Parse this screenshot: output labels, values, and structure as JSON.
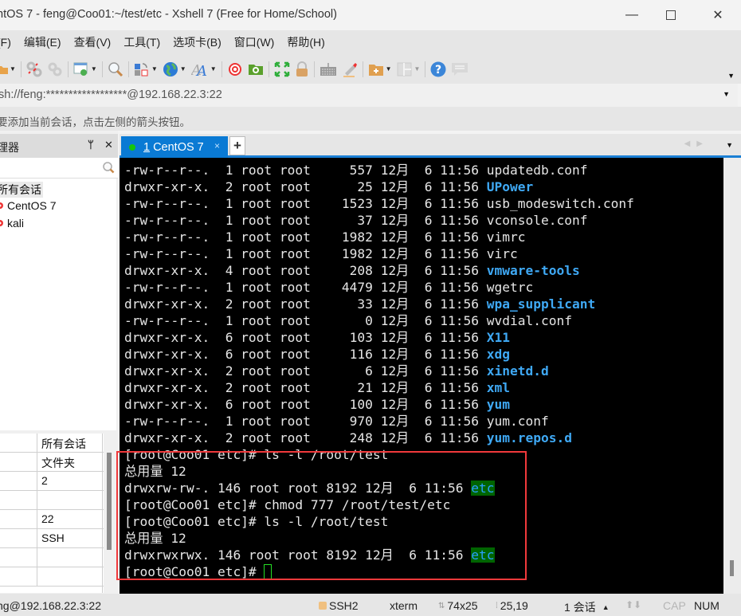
{
  "window": {
    "title": "ntOS 7 - feng@Coo01:~/test/etc - Xshell 7 (Free for Home/School)",
    "minimize_glyph": "—",
    "close_glyph": "✕"
  },
  "menu": [
    "(F)",
    "编辑(E)",
    "查看(V)",
    "工具(T)",
    "选项卡(B)",
    "窗口(W)",
    "帮助(H)"
  ],
  "toolbar": {
    "buttons": [
      "open-folder",
      "disconnect",
      "reconnect",
      "session-properties",
      "find",
      "transfer",
      "globe",
      "font",
      "xftp-swirl",
      "xftp",
      "fullscreen",
      "lock",
      "keyboard",
      "highlighter",
      "new-folder",
      "layout",
      "help",
      "chat"
    ],
    "more_glyph": "▼"
  },
  "address": {
    "value": "sh://feng:******************@192.168.22.3:22",
    "drop_glyph": "▼"
  },
  "hint": "要添加当前会话，点击左侧的箭头按钮。",
  "session_panel": {
    "title": "理器",
    "pin_glyph": "ᛘ",
    "close_glyph": "✕",
    "tree": {
      "root": "所有会话",
      "children": [
        "CentOS 7",
        "kali"
      ]
    },
    "properties": [
      "所有会话",
      "文件夹",
      "2",
      "",
      "22",
      "SSH",
      "",
      ""
    ]
  },
  "tabs": {
    "items": [
      {
        "number": "1",
        "label": "CentOS 7",
        "status_color": "#16c60c"
      }
    ],
    "close_glyph": "×",
    "add_glyph": "+",
    "nav_glyphs": "◀▶",
    "menu_glyph": "▼"
  },
  "terminal": {
    "listing": [
      {
        "perm": "-rw-r--r--.",
        "links": "1",
        "user": "root",
        "group": "root",
        "size": "557",
        "month": "12月",
        "day": "6",
        "time": "11:56",
        "name": "updatedb.conf",
        "dir": false
      },
      {
        "perm": "drwxr-xr-x.",
        "links": "2",
        "user": "root",
        "group": "root",
        "size": "25",
        "month": "12月",
        "day": "6",
        "time": "11:56",
        "name": "UPower",
        "dir": true
      },
      {
        "perm": "-rw-r--r--.",
        "links": "1",
        "user": "root",
        "group": "root",
        "size": "1523",
        "month": "12月",
        "day": "6",
        "time": "11:56",
        "name": "usb_modeswitch.conf",
        "dir": false
      },
      {
        "perm": "-rw-r--r--.",
        "links": "1",
        "user": "root",
        "group": "root",
        "size": "37",
        "month": "12月",
        "day": "6",
        "time": "11:56",
        "name": "vconsole.conf",
        "dir": false
      },
      {
        "perm": "-rw-r--r--.",
        "links": "1",
        "user": "root",
        "group": "root",
        "size": "1982",
        "month": "12月",
        "day": "6",
        "time": "11:56",
        "name": "vimrc",
        "dir": false
      },
      {
        "perm": "-rw-r--r--.",
        "links": "1",
        "user": "root",
        "group": "root",
        "size": "1982",
        "month": "12月",
        "day": "6",
        "time": "11:56",
        "name": "virc",
        "dir": false
      },
      {
        "perm": "drwxr-xr-x.",
        "links": "4",
        "user": "root",
        "group": "root",
        "size": "208",
        "month": "12月",
        "day": "6",
        "time": "11:56",
        "name": "vmware-tools",
        "dir": true
      },
      {
        "perm": "-rw-r--r--.",
        "links": "1",
        "user": "root",
        "group": "root",
        "size": "4479",
        "month": "12月",
        "day": "6",
        "time": "11:56",
        "name": "wgetrc",
        "dir": false
      },
      {
        "perm": "drwxr-xr-x.",
        "links": "2",
        "user": "root",
        "group": "root",
        "size": "33",
        "month": "12月",
        "day": "6",
        "time": "11:56",
        "name": "wpa_supplicant",
        "dir": true
      },
      {
        "perm": "-rw-r--r--.",
        "links": "1",
        "user": "root",
        "group": "root",
        "size": "0",
        "month": "12月",
        "day": "6",
        "time": "11:56",
        "name": "wvdial.conf",
        "dir": false
      },
      {
        "perm": "drwxr-xr-x.",
        "links": "6",
        "user": "root",
        "group": "root",
        "size": "103",
        "month": "12月",
        "day": "6",
        "time": "11:56",
        "name": "X11",
        "dir": true
      },
      {
        "perm": "drwxr-xr-x.",
        "links": "6",
        "user": "root",
        "group": "root",
        "size": "116",
        "month": "12月",
        "day": "6",
        "time": "11:56",
        "name": "xdg",
        "dir": true
      },
      {
        "perm": "drwxr-xr-x.",
        "links": "2",
        "user": "root",
        "group": "root",
        "size": "6",
        "month": "12月",
        "day": "6",
        "time": "11:56",
        "name": "xinetd.d",
        "dir": true
      },
      {
        "perm": "drwxr-xr-x.",
        "links": "2",
        "user": "root",
        "group": "root",
        "size": "21",
        "month": "12月",
        "day": "6",
        "time": "11:56",
        "name": "xml",
        "dir": true
      },
      {
        "perm": "drwxr-xr-x.",
        "links": "6",
        "user": "root",
        "group": "root",
        "size": "100",
        "month": "12月",
        "day": "6",
        "time": "11:56",
        "name": "yum",
        "dir": true
      },
      {
        "perm": "-rw-r--r--.",
        "links": "1",
        "user": "root",
        "group": "root",
        "size": "970",
        "month": "12月",
        "day": "6",
        "time": "11:56",
        "name": "yum.conf",
        "dir": false
      },
      {
        "perm": "drwxr-xr-x.",
        "links": "2",
        "user": "root",
        "group": "root",
        "size": "248",
        "month": "12月",
        "day": "6",
        "time": "11:56",
        "name": "yum.repos.d",
        "dir": true
      }
    ],
    "session": [
      {
        "text": "[root@Coo01 etc]# ls -l /root/test"
      },
      {
        "text": "总用量 12"
      },
      {
        "text": "drwxrw-rw-. 146 root root 8192 12月  6 11:56 ",
        "hl": "etc"
      },
      {
        "text": "[root@Coo01 etc]# chmod 777 /root/test/etc"
      },
      {
        "text": "[root@Coo01 etc]# ls -l /root/test"
      },
      {
        "text": "总用量 12"
      },
      {
        "text": "drwxrwxrwx. 146 root root 8192 12月  6 11:56 ",
        "hl": "etc"
      },
      {
        "text": "[root@Coo01 etc]# ",
        "cursor": true
      }
    ]
  },
  "statusbar": {
    "connection": "ng@192.168.22.3:22",
    "protocol": "SSH2",
    "term": "xterm",
    "size": "74x25",
    "cursor_pos": "25,19",
    "sessions": "1 会话",
    "sessions_arrow": "▲",
    "nav_arrows": "⬆⬇",
    "cap": "CAP",
    "num": "NUM"
  },
  "colors": {
    "accent": "#0a7ad4",
    "highlight_box": "#f0393b",
    "dir_text": "#3fa9f5",
    "cursor": "#25e025"
  }
}
